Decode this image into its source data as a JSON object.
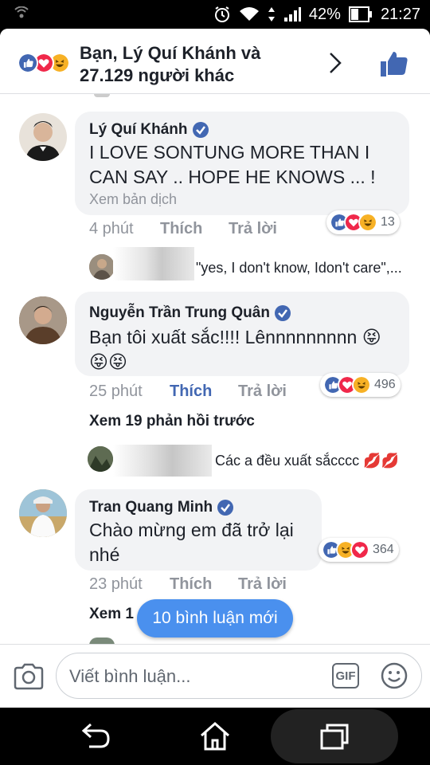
{
  "status": {
    "battery": "42%",
    "time": "21:27"
  },
  "reactions_header": {
    "line1": "Bạn, Lý Quí Khánh và",
    "line2": "27.129 người khác"
  },
  "comments": [
    {
      "name": "Lý Quí Khánh",
      "text_line1": "I LOVE SONTUNG MORE THAN I",
      "text_line2": "CAN SAY .. HOPE HE KNOWS ... !",
      "translate": "Xem bản dịch",
      "time": "4 phút",
      "like": "Thích",
      "reply": "Trả lời",
      "reaction_count": "13"
    },
    {
      "name": "Nguyễn Trần Trung Quân",
      "text_line1": "Bạn tôi xuất sắc!!!! Lênnnnnnnnn 😝",
      "text_line2": "😝😝",
      "time": "25 phút",
      "like": "Thích",
      "reply": "Trả lời",
      "reaction_count": "496"
    },
    {
      "name": "Tran Quang Minh",
      "text_line1": "Chào mừng em đã trở lại",
      "text_line2": "nhé",
      "time": "23 phút",
      "like": "Thích",
      "reply": "Trả lời",
      "reaction_count": "364"
    }
  ],
  "replies": [
    {
      "text": "\"yes, I don't know, Idon't care\",..."
    },
    {
      "text": "Các a đều xuất sắcccc 💋💋"
    }
  ],
  "see_previous": "Xem 19 phản hồi trước",
  "see_more_partial": "Xem 1",
  "new_comments_pill": "10 bình luận mới",
  "composer": {
    "placeholder": "Viết bình luận...",
    "gif": "GIF"
  },
  "colors": {
    "fb_blue": "#4267b2",
    "love_red": "#f0284a",
    "haha_yellow": "#f7b125",
    "pill_blue": "#4a90ee"
  },
  "icons": [
    "back-icon",
    "home-icon",
    "recents-icon",
    "camera-icon",
    "smile-icon",
    "thumbs-up-icon",
    "chevron-right-icon",
    "verified-icon"
  ]
}
